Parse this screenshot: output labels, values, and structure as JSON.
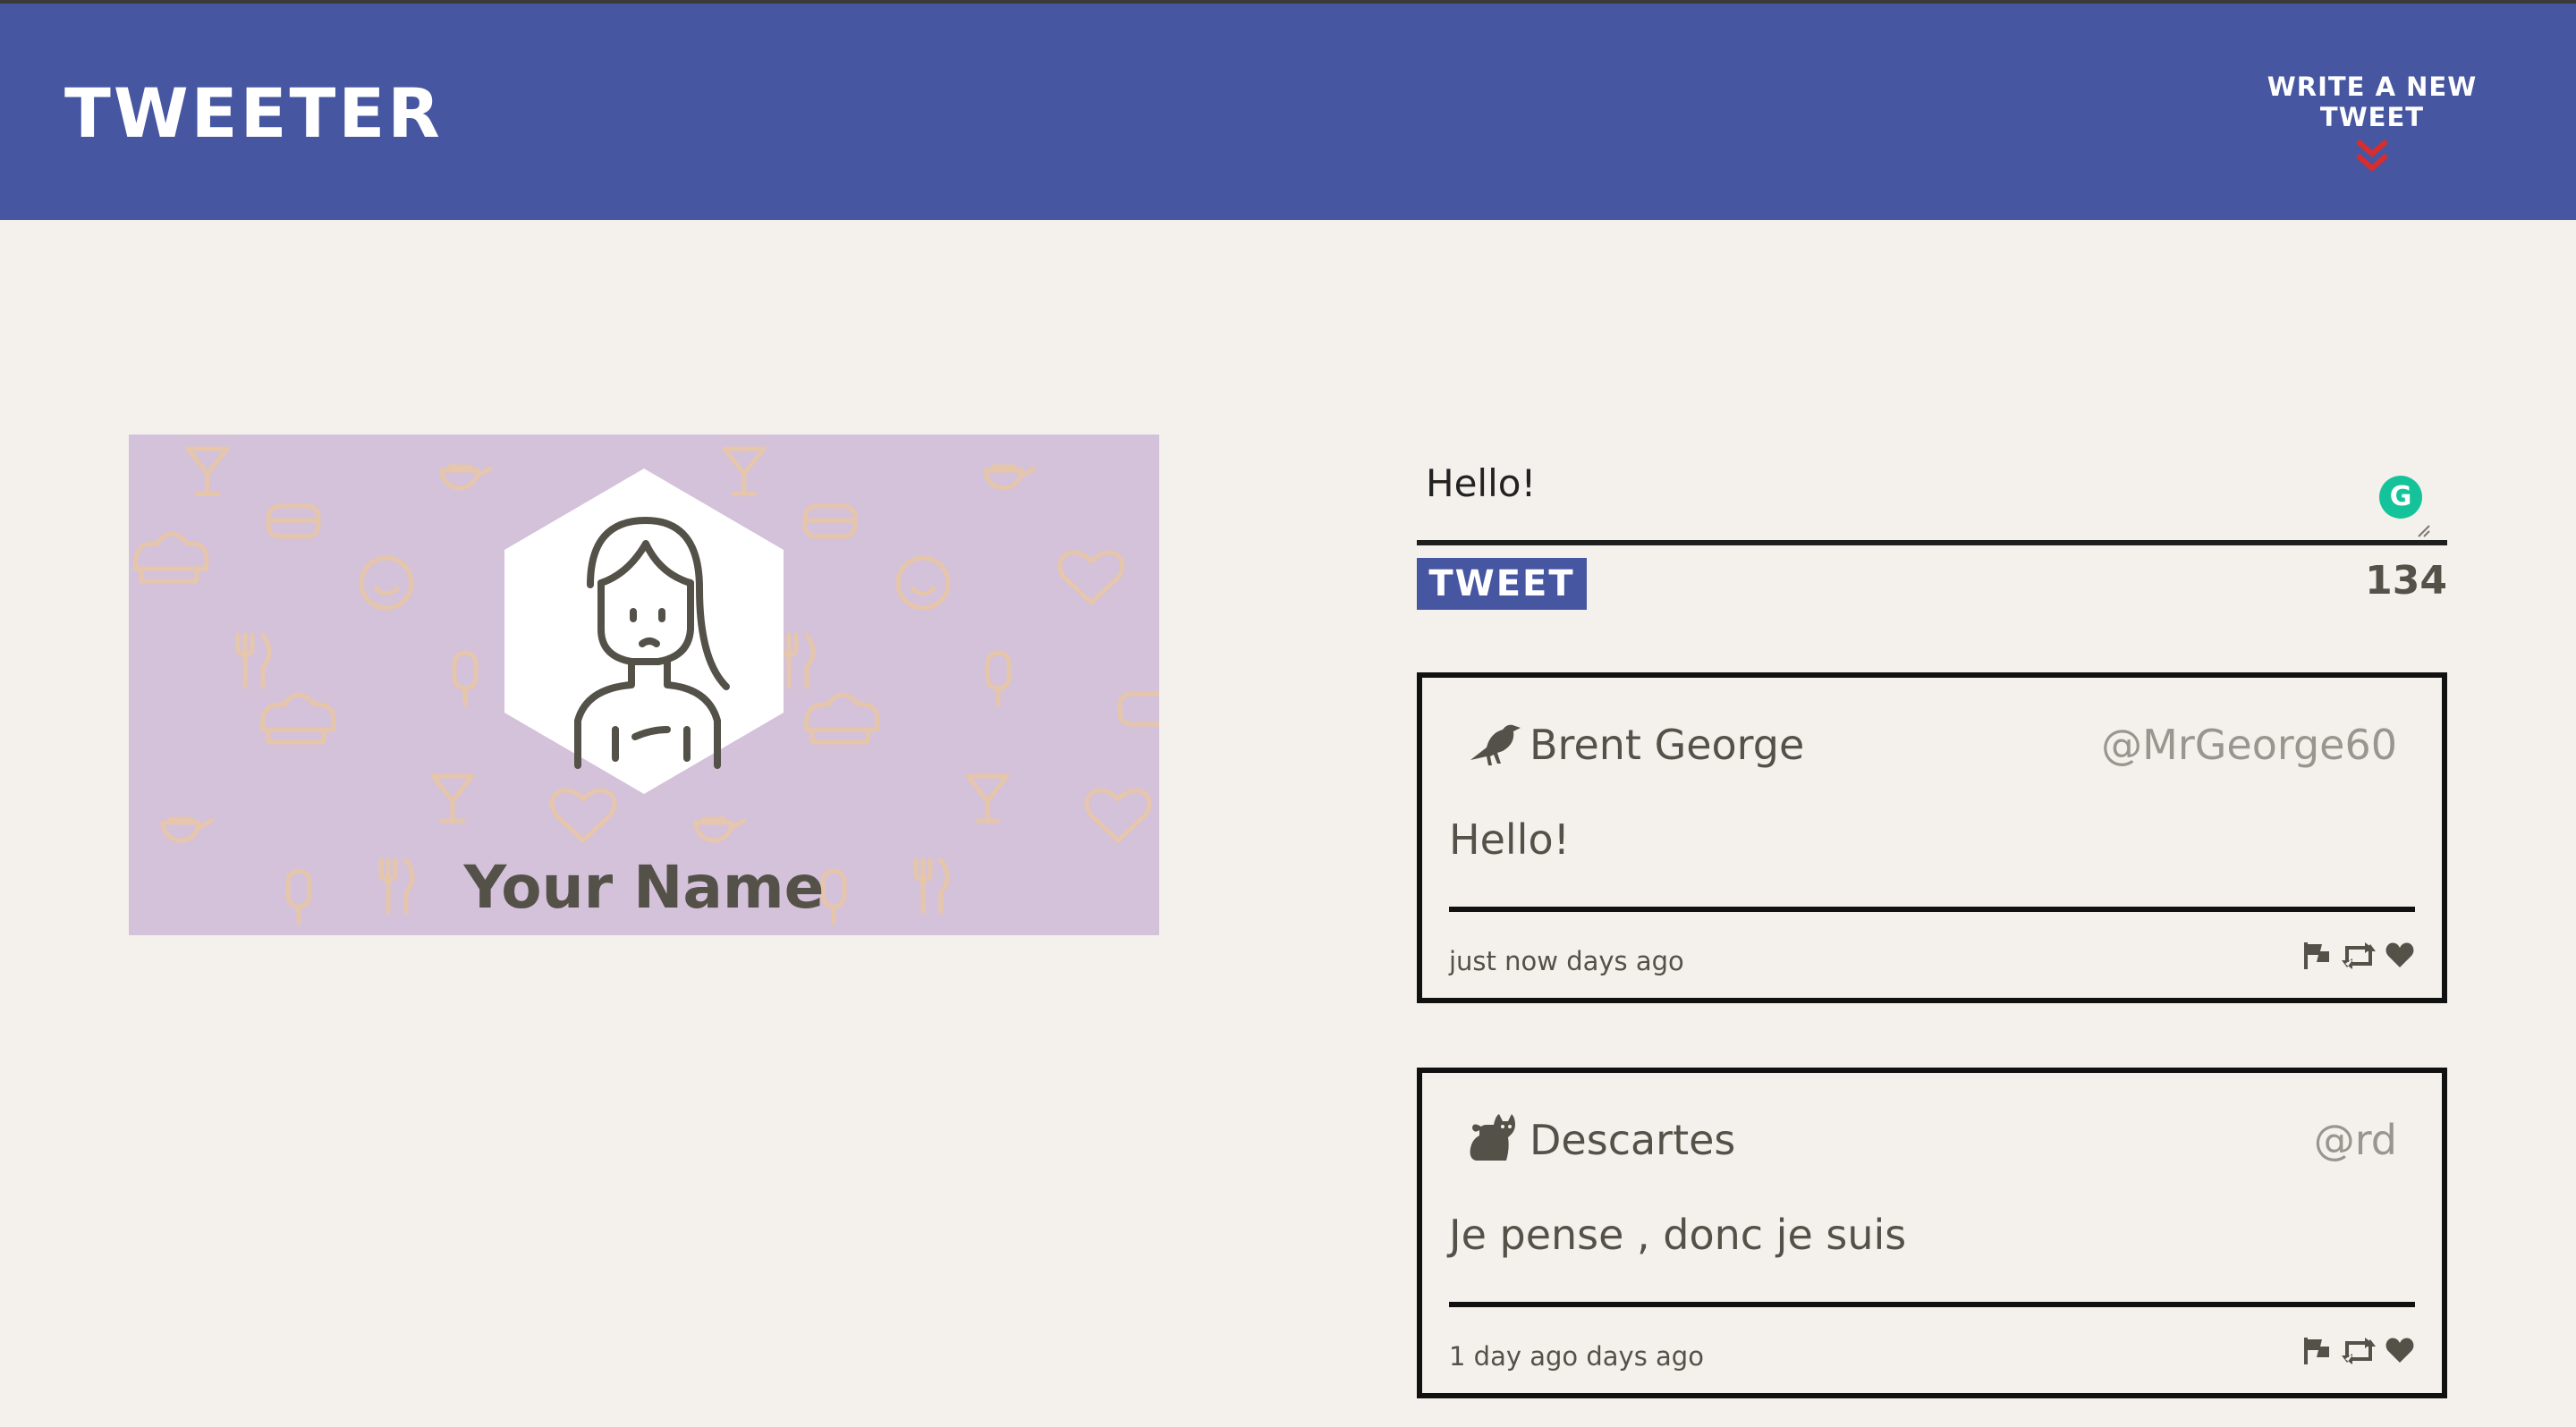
{
  "nav": {
    "brand": "TWEETER",
    "compose_label": "WRITE A NEW TWEET",
    "compose_icon": "double-chevron-down-icon",
    "accent_color": "#d62e2e",
    "bar_color": "#4656a1"
  },
  "profile": {
    "name": "Your Name",
    "avatar_icon": "woman-avatar-icon",
    "background_color": "#d4c1da"
  },
  "composer": {
    "text": "Hello!",
    "button_label": "TWEET",
    "counter": "134",
    "grammar_icon": "grammarly-icon",
    "grammar_letter": "G"
  },
  "tweets": [
    {
      "name": "Brent George",
      "handle": "@MrGeorge60",
      "text": "Hello!",
      "time": "just now days ago",
      "avatar_icon": "crow-icon"
    },
    {
      "name": "Descartes",
      "handle": "@rd",
      "text": "Je pense , donc je suis",
      "time": "1 day ago days ago",
      "avatar_icon": "cat-icon"
    }
  ],
  "actions": [
    "flag-icon",
    "retweet-icon",
    "heart-icon"
  ]
}
